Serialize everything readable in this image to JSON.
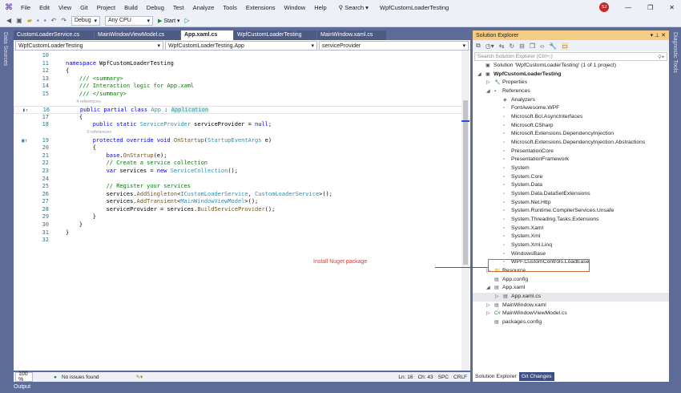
{
  "menu": {
    "items": [
      "File",
      "Edit",
      "View",
      "Git",
      "Project",
      "Build",
      "Debug",
      "Test",
      "Analyze",
      "Tools",
      "Extensions",
      "Window",
      "Help"
    ],
    "search": "Search",
    "title": "WpfCustomLoaderTesting",
    "avatar": "SJ"
  },
  "toolbar": {
    "config": "Debug",
    "platform": "Any CPU",
    "start": "Start"
  },
  "left_strip": "Data Sources",
  "right_strip": "Diagnostic Tools",
  "doc_tabs": [
    {
      "label": "CustomLoaderService.cs"
    },
    {
      "label": "MainWindowViewModel.cs"
    },
    {
      "label": "App.xaml.cs",
      "active": true
    },
    {
      "label": "WpfCustomLoaderTesting"
    },
    {
      "label": "MainWindow.xaml.cs"
    }
  ],
  "navbar": {
    "project": "WpfCustomLoaderTesting",
    "type": "WpfCustomLoaderTesting.App",
    "member": "serviceProvider"
  },
  "code": [
    {
      "n": "10",
      "s": []
    },
    {
      "n": "11",
      "s": [
        [
          "kw",
          "namespace "
        ],
        [
          "pl",
          "WpfCustomLoaderTesting"
        ]
      ]
    },
    {
      "n": "12",
      "s": [
        [
          "pl",
          "{"
        ]
      ]
    },
    {
      "n": "13",
      "s": [
        [
          "cm",
          "    /// <summary>"
        ]
      ]
    },
    {
      "n": "14",
      "s": [
        [
          "cm",
          "    /// Interaction logic for App.xaml"
        ]
      ]
    },
    {
      "n": "15",
      "s": [
        [
          "cm",
          "    /// </summary>"
        ]
      ]
    },
    {
      "lens": "4 references",
      "indent": "    "
    },
    {
      "n": "16",
      "s": [
        [
          "kw",
          "    public partial class "
        ],
        [
          "ty",
          "App"
        ],
        [
          "pl",
          " : "
        ],
        [
          "hl",
          "Application"
        ]
      ]
    },
    {
      "n": "17",
      "s": [
        [
          "pl",
          "    {"
        ]
      ]
    },
    {
      "n": "18",
      "s": [
        [
          "kw",
          "        public static "
        ],
        [
          "ty",
          "ServiceProvider"
        ],
        [
          "pl",
          " serviceProvider = "
        ],
        [
          "kw",
          "null"
        ],
        [
          "pl",
          ";"
        ]
      ]
    },
    {
      "lens": "0 references",
      "indent": "        "
    },
    {
      "n": "19",
      "s": [
        [
          "kw",
          "        protected override void "
        ],
        [
          "mt",
          "OnStartup"
        ],
        [
          "pl",
          "("
        ],
        [
          "ty",
          "StartupEventArgs"
        ],
        [
          "pl",
          " e)"
        ]
      ]
    },
    {
      "n": "20",
      "s": [
        [
          "pl",
          "        {"
        ]
      ]
    },
    {
      "n": "21",
      "s": [
        [
          "kw",
          "            base"
        ],
        [
          "pl",
          "."
        ],
        [
          "mt",
          "OnStartup"
        ],
        [
          "pl",
          "(e);"
        ]
      ]
    },
    {
      "n": "22",
      "s": [
        [
          "cm",
          "            // Create a service collection"
        ]
      ]
    },
    {
      "n": "23",
      "s": [
        [
          "kw",
          "            var"
        ],
        [
          "pl",
          " services = "
        ],
        [
          "kw",
          "new "
        ],
        [
          "ty",
          "ServiceCollection"
        ],
        [
          "pl",
          "();"
        ]
      ]
    },
    {
      "n": "24",
      "s": []
    },
    {
      "n": "25",
      "s": [
        [
          "cm",
          "            // Register your services"
        ]
      ]
    },
    {
      "n": "26",
      "s": [
        [
          "pl",
          "            services."
        ],
        [
          "mt",
          "AddSingleton"
        ],
        [
          "pl",
          "<"
        ],
        [
          "ty",
          "ICustomLoaderService"
        ],
        [
          "pl",
          ", "
        ],
        [
          "ty",
          "CustomLoaderService"
        ],
        [
          "pl",
          ">();"
        ]
      ]
    },
    {
      "n": "27",
      "s": [
        [
          "pl",
          "            services."
        ],
        [
          "mt",
          "AddTransient"
        ],
        [
          "pl",
          "<"
        ],
        [
          "ty",
          "MainWindowViewModel"
        ],
        [
          "pl",
          ">();"
        ]
      ]
    },
    {
      "n": "28",
      "s": [
        [
          "pl",
          "            serviceProvider = services."
        ],
        [
          "mt",
          "BuildServiceProvider"
        ],
        [
          "pl",
          "();"
        ]
      ]
    },
    {
      "n": "29",
      "s": [
        [
          "pl",
          "        }"
        ]
      ]
    },
    {
      "n": "30",
      "s": [
        [
          "pl",
          "    }"
        ]
      ]
    },
    {
      "n": "31",
      "s": [
        [
          "pl",
          "}"
        ]
      ]
    },
    {
      "n": "32",
      "s": []
    }
  ],
  "status": {
    "zoom": "100 %",
    "issues": "No issues found",
    "ln": "Ln: 16",
    "ch": "Ch: 43",
    "spc": "SPC",
    "crlf": "CRLF"
  },
  "output_label": "Output",
  "solution_explorer": {
    "title": "Solution Explorer",
    "search_placeholder": "Search Solution Explorer (Ctrl+;)",
    "tree": [
      {
        "d": 0,
        "i": "▣",
        "l": "Solution 'WpfCustomLoaderTesting' (1 of 1 project)"
      },
      {
        "d": 0,
        "e": "◢",
        "i": "▣",
        "l": "WpfCustomLoaderTesting",
        "b": true
      },
      {
        "d": 1,
        "e": "▷",
        "i": "🔧",
        "l": "Properties"
      },
      {
        "d": 1,
        "e": "◢",
        "i": "▪",
        "l": "References"
      },
      {
        "d": 2,
        "i": "◈",
        "l": "Analyzers"
      },
      {
        "d": 2,
        "i": "▫",
        "l": "FontAwesome.WPF"
      },
      {
        "d": 2,
        "i": "▫",
        "l": "Microsoft.Bcl.AsyncInterfaces"
      },
      {
        "d": 2,
        "i": "▫",
        "l": "Microsoft.CSharp"
      },
      {
        "d": 2,
        "i": "▫",
        "l": "Microsoft.Extensions.DependencyInjection"
      },
      {
        "d": 2,
        "i": "▫",
        "l": "Microsoft.Extensions.DependencyInjection.Abstractions"
      },
      {
        "d": 2,
        "i": "▫",
        "l": "PresentationCore"
      },
      {
        "d": 2,
        "i": "▫",
        "l": "PresentationFramework"
      },
      {
        "d": 2,
        "i": "▫",
        "l": "System"
      },
      {
        "d": 2,
        "i": "▫",
        "l": "System.Core"
      },
      {
        "d": 2,
        "i": "▫",
        "l": "System.Data"
      },
      {
        "d": 2,
        "i": "▫",
        "l": "System.Data.DataSetExtensions"
      },
      {
        "d": 2,
        "i": "▫",
        "l": "System.Net.Http"
      },
      {
        "d": 2,
        "i": "▫",
        "l": "System.Runtime.CompilerServices.Unsafe"
      },
      {
        "d": 2,
        "i": "▫",
        "l": "System.Threading.Tasks.Extensions"
      },
      {
        "d": 2,
        "i": "▫",
        "l": "System.Xaml"
      },
      {
        "d": 2,
        "i": "▫",
        "l": "System.Xml"
      },
      {
        "d": 2,
        "i": "▫",
        "l": "System.Xml.Linq"
      },
      {
        "d": 2,
        "i": "▫",
        "l": "WindowsBase"
      },
      {
        "d": 2,
        "i": "▫",
        "l": "WPF.CustomControls.LoadEase"
      },
      {
        "d": 1,
        "e": "▷",
        "i": "📁",
        "l": "Resource"
      },
      {
        "d": 1,
        "i": "▤",
        "l": "App.config"
      },
      {
        "d": 1,
        "e": "◢",
        "i": "▤",
        "l": "App.xaml"
      },
      {
        "d": 2,
        "e": "▷",
        "i": "▤",
        "l": "App.xaml.cs",
        "sel": true
      },
      {
        "d": 1,
        "e": "▷",
        "i": "▤",
        "l": "MainWindow.xaml"
      },
      {
        "d": 1,
        "e": "▷",
        "i": "C#",
        "l": "MainWindowViewModel.cs"
      },
      {
        "d": 1,
        "i": "▤",
        "l": "packages.config"
      }
    ],
    "tabs": [
      "Solution Explorer",
      "Git Changes"
    ]
  },
  "annotation": "Install Nuget package"
}
